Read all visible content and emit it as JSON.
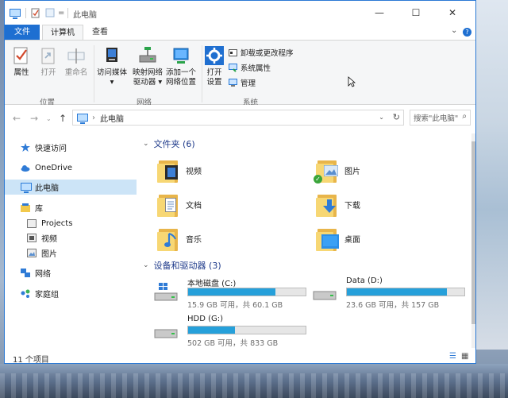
{
  "titlebar": {
    "title": "此电脑",
    "minimize_glyph": "—",
    "maximize_glyph": "☐",
    "close_glyph": "✕"
  },
  "ribbon_tabs": {
    "file": "文件",
    "computer": "计算机",
    "view": "查看"
  },
  "ribbon": {
    "properties": "属性",
    "open": "打开",
    "rename": "重命名",
    "access_media": "访问媒体",
    "map_drive_line1": "映射网络",
    "map_drive_line2": "驱动器",
    "add_location_line1": "添加一个",
    "add_location_line2": "网络位置",
    "open_settings_line1": "打开",
    "open_settings_line2": "设置",
    "uninstall": "卸载或更改程序",
    "system_properties": "系统属性",
    "manage": "管理",
    "group_location": "位置",
    "group_network": "网络",
    "group_system": "系统"
  },
  "navbar": {
    "back": "←",
    "forward": "→",
    "up": "↑",
    "path_sep": "›",
    "path": "此电脑",
    "search_placeholder": "搜索\"此电脑\""
  },
  "sidebar": {
    "items": [
      {
        "label": "快速访问"
      },
      {
        "label": "OneDrive"
      },
      {
        "label": "此电脑"
      },
      {
        "label": "库"
      },
      {
        "label": "Projects"
      },
      {
        "label": "视频"
      },
      {
        "label": "图片"
      },
      {
        "label": "网络"
      },
      {
        "label": "家庭组"
      }
    ]
  },
  "folders_group": {
    "title": "文件夹 (6)"
  },
  "folders": [
    {
      "label": "视频"
    },
    {
      "label": "图片"
    },
    {
      "label": "文档"
    },
    {
      "label": "下载"
    },
    {
      "label": "音乐"
    },
    {
      "label": "桌面"
    }
  ],
  "drives_group": {
    "title": "设备和驱动器 (3)"
  },
  "drives": [
    {
      "name": "本地磁盘 (C:)",
      "space": "15.9 GB 可用，共 60.1 GB",
      "used_fraction": 0.74
    },
    {
      "name": "Data (D:)",
      "space": "23.6 GB 可用，共 157 GB",
      "used_fraction": 0.85
    },
    {
      "name": "HDD (G:)",
      "space": "502 GB 可用，共 833 GB",
      "used_fraction": 0.4
    }
  ],
  "status": {
    "count": "11 个项目"
  },
  "colors": {
    "accent": "#1e6fd1",
    "drive_bar": "#26a0da",
    "folder": "#f7d774"
  }
}
